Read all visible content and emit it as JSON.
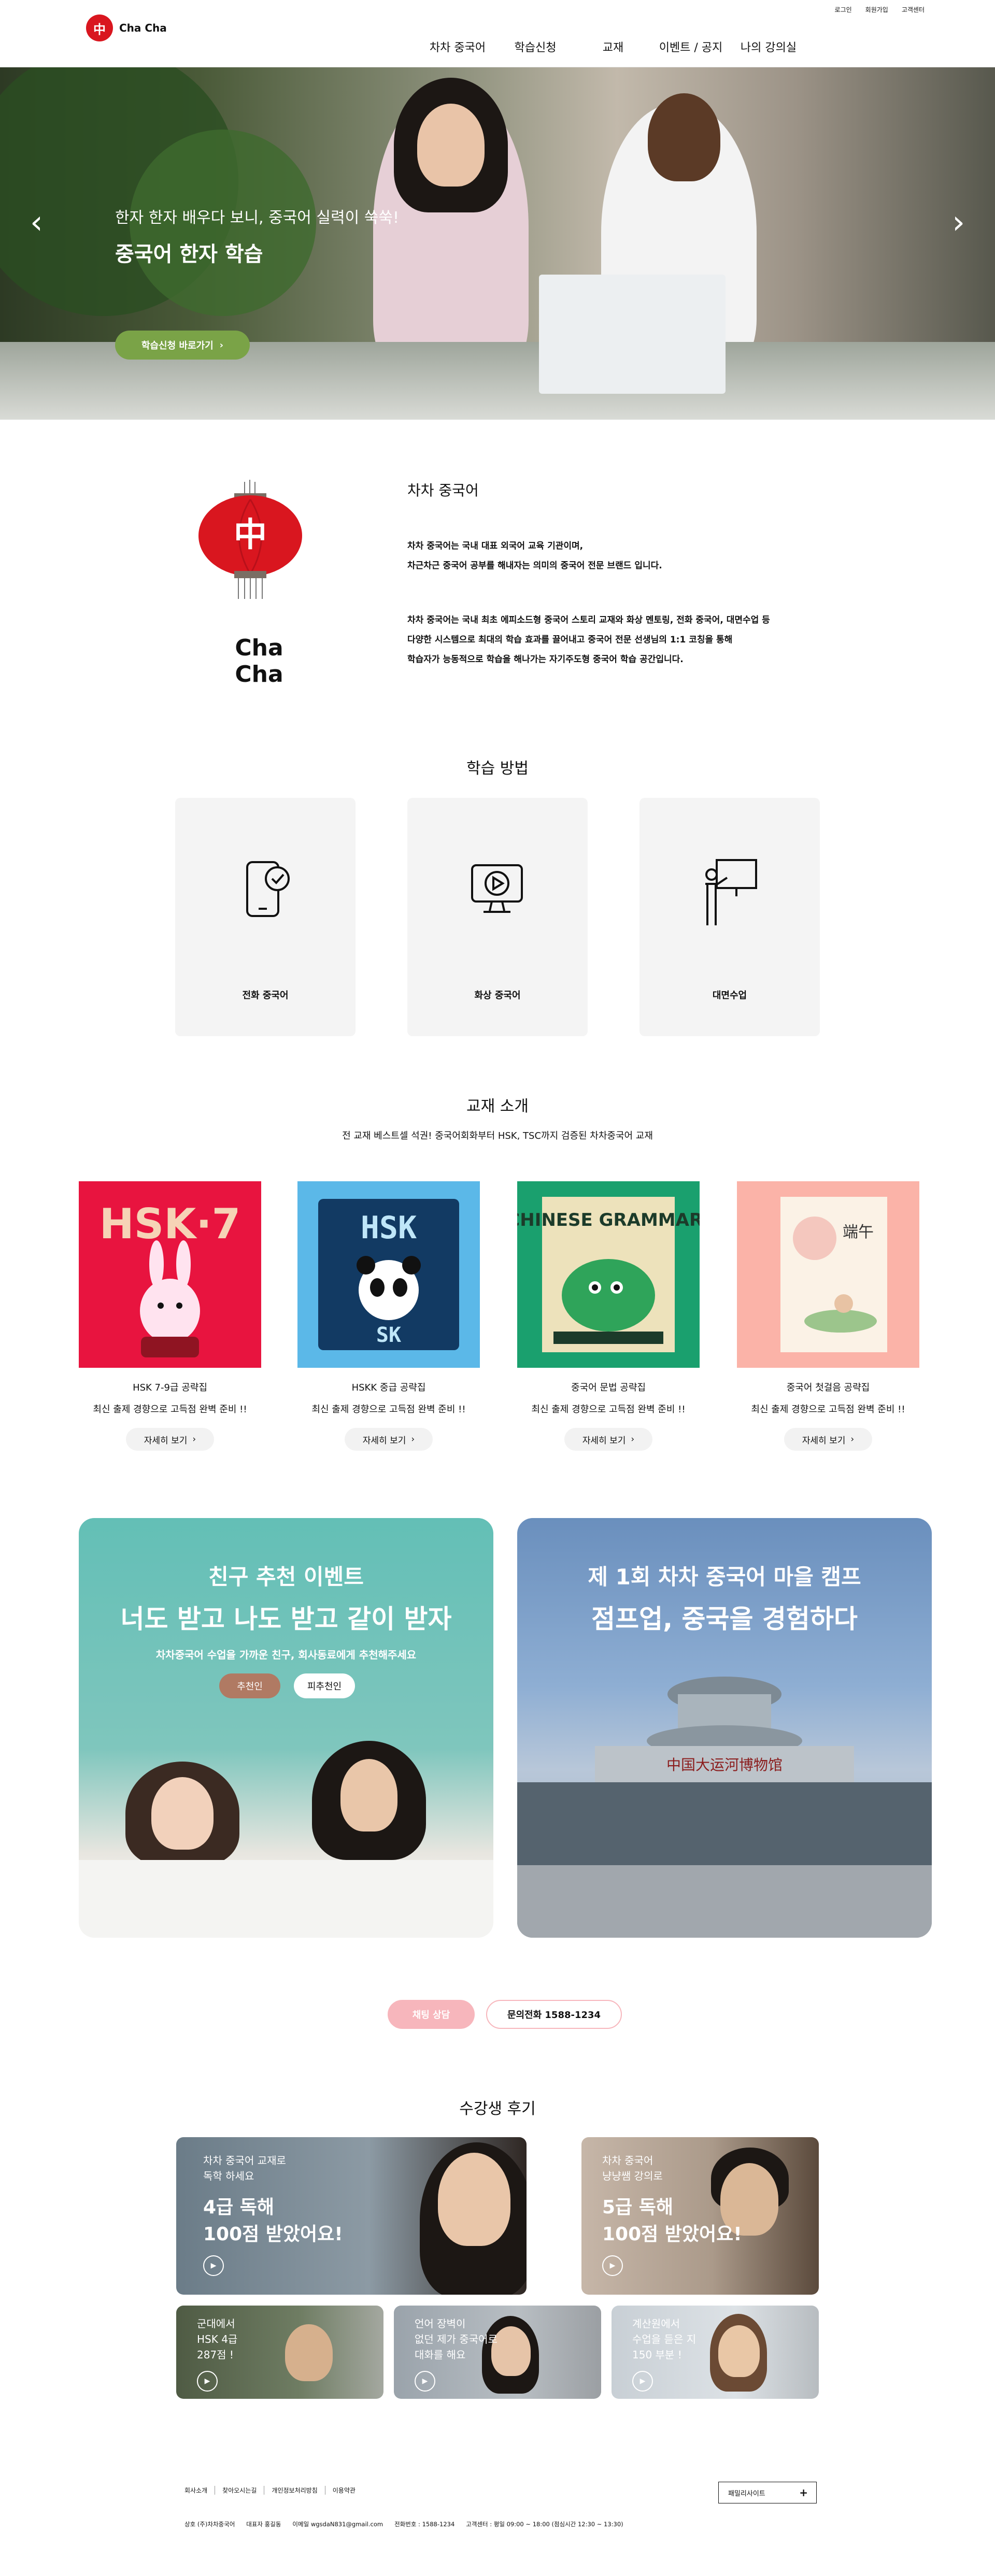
{
  "util_links": [
    "로그인",
    "회원가입",
    "고객센터"
  ],
  "brand": {
    "name": "Cha Cha",
    "mark": "中"
  },
  "nav": [
    "차차 중국어",
    "학습신청",
    "교재",
    "이벤트 / 공지",
    "나의 강의실"
  ],
  "hero": {
    "subtitle": "한자 한자 배우다 보니, 중국어 실력이 쑥쑥!",
    "title": "중국어 한자 학습",
    "button": "학습신청 바로가기",
    "prev": "‹",
    "next": "›"
  },
  "about": {
    "logo_name": "Cha Cha",
    "title": "차차 중국어",
    "p1": [
      "차차 중국어는 국내 대표 외국어 교육 기관이며,",
      "차근차근 중국어 공부를 해내자는 의미의 중국어 전문 브랜드 입니다."
    ],
    "p2": [
      "차차 중국어는 국내 최초 에피소드형 중국어 스토리 교재와 화상 멘토링, 전화 중국어, 대면수업 등",
      "다양한 시스템으로 최대의 학습 효과를 끌어내고 중국어 전문 선생님의 1:1 코칭을 통해",
      "학습자가 능동적으로 학습을 해나가는 자기주도형 중국어 학습 공간입니다."
    ]
  },
  "methods": {
    "title": "학습 방법",
    "items": [
      {
        "label": "전화 중국어",
        "icon": "phone-check-icon"
      },
      {
        "label": "화상 중국어",
        "icon": "video-monitor-icon"
      },
      {
        "label": "대면수업",
        "icon": "teacher-board-icon"
      }
    ]
  },
  "books": {
    "title": "교재 소개",
    "subtitle": "전 교재 베스트셀 석권! 중국어회화부터 HSK, TSC까지 검증된 차차중국어 교재",
    "more": "자세히 보기",
    "items": [
      {
        "title": "HSK 7-9급 공략집",
        "desc": "최신 출제 경향으로 고득점 완벽 준비 !!",
        "cover": "HSK·7",
        "cover_bg": "#e8143f"
      },
      {
        "title": "HSKK 중급 공략집",
        "desc": "최신 출제 경향으로 고득점 완벽 준비 !!",
        "cover": "HSK",
        "cover_bg": "#5bb8e8"
      },
      {
        "title": "중국어 문법 공략집",
        "desc": "최신 출제 경향으로 고득점 완벽 준비 !!",
        "cover": "CHINESE GRAMMAR:",
        "cover_bg": "#1aa06e"
      },
      {
        "title": "중국어 첫걸음 공략집",
        "desc": "최신 출제 경향으로 고득점 완벽 준비 !!",
        "cover": "端午",
        "cover_bg": "#fbb3a8"
      }
    ]
  },
  "events": [
    {
      "title": "친구 추천 이벤트",
      "headline": "너도 받고 나도 받고 같이 받자",
      "desc": "차차중국어 수업을 가까운 친구, 회사동료에게 추천해주세요",
      "btn1": "추천인",
      "btn2": "피추천인"
    },
    {
      "title": "제 1회 차차 중국어 마을 캠프",
      "headline": "점프업, 중국을 경험하다",
      "sign": "中国大运河博物馆"
    }
  ],
  "consult": {
    "chat": "채팅 상담",
    "phone": "문의전화 1588-1234"
  },
  "reviews": {
    "title": "수강생 후기",
    "items": [
      {
        "small": [
          "차차 중국어 교재로",
          "독학 하세요"
        ],
        "big": [
          "4급 독해",
          "100점 받았어요!"
        ]
      },
      {
        "small": [
          "차차 중국어",
          "냥냥쌤 강의로"
        ],
        "big": [
          "5급 독해",
          "100점 받았어요!"
        ]
      },
      {
        "small": [
          "군대에서",
          "HSK 4급",
          "287점 !"
        ],
        "big": []
      },
      {
        "small": [
          "언어 장벽이",
          "없던 제가 중국어로",
          "대화를 해요"
        ],
        "big": []
      },
      {
        "small": [
          "계산원에서",
          "수업을 듣은 지",
          "150 부분 !"
        ],
        "big": []
      }
    ]
  },
  "footer": {
    "links": [
      "회사소개",
      "찾아오시는길",
      "개인정보처리방침",
      "이용약관"
    ],
    "family_site": "패밀리사이트",
    "family_plus": "+",
    "info": [
      "상호 (주)차차중국어",
      "대표자 홍길동",
      "이메일 wgsdaN831@gmail.com",
      "전화번호 : 1588-1234",
      "고객센터 : 평일 09:00 ~ 18:00 (점심시간 12:30 ~ 13:30)"
    ]
  }
}
